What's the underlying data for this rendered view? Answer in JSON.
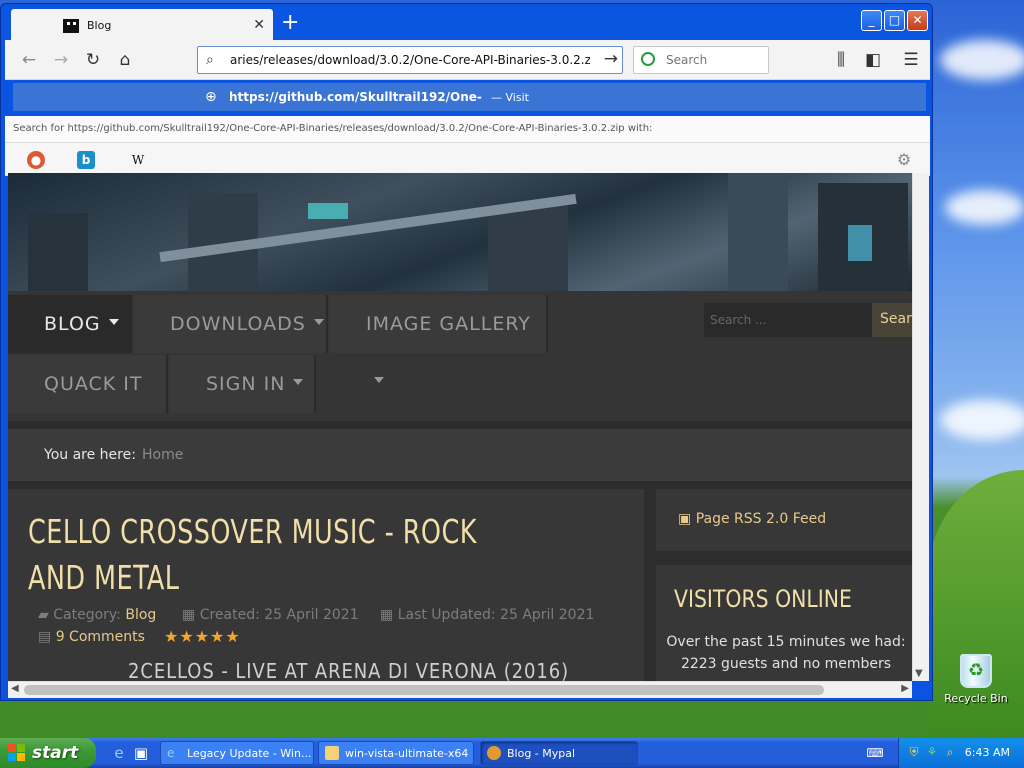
{
  "browser": {
    "tab_title": "Blog",
    "address": "aries/releases/download/3.0.2/One-Core-API-Binaries-3.0.2.zip",
    "search_placeholder": "Search",
    "suggestion_url": "https://github.com/Skulltrail192/One-",
    "suggestion_action": "— Visit",
    "search_for_prefix": "Search for",
    "search_for_url": "https://github.com/Skulltrail192/One-Core-API-Binaries/releases/download/3.0.2/One-Core-API-Binaries-3.0.2.zip",
    "search_for_suffix": "with:",
    "search_engines": [
      "DuckDuckGo",
      "Bing",
      "Wikipedia"
    ]
  },
  "site": {
    "menu": [
      {
        "label": "BLOG",
        "has_dropdown": true
      },
      {
        "label": "DOWNLOADS",
        "has_dropdown": true
      },
      {
        "label": "IMAGE GALLERY",
        "has_dropdown": true
      },
      {
        "label": "QUACK IT",
        "has_dropdown": false
      },
      {
        "label": "SIGN IN",
        "has_dropdown": true
      }
    ],
    "search_placeholder": "Search ...",
    "search_button": "Sear",
    "breadcrumb_label": "You are here:",
    "breadcrumb_home": "Home",
    "article": {
      "title": "CELLO CROSSOVER MUSIC - ROCK AND METAL",
      "category_label": "Category:",
      "category": "Blog",
      "created": "Created: 25 April 2021",
      "updated": "Last Updated: 25 April 2021",
      "comments": "9 Comments",
      "rating_stars": 5,
      "video_title": "2CELLOS - LIVE AT ARENA DI VERONA (2016)"
    },
    "sidebar": {
      "rss": "Page RSS 2.0 Feed",
      "visitors_title": "VISITORS ONLINE",
      "visitors_text": "Over the past 15 minutes we had:",
      "visitors_count": "2223 guests and no members"
    }
  },
  "desktop": {
    "recycle_bin": "Recycle Bin"
  },
  "taskbar": {
    "start": "start",
    "tasks": [
      "Legacy Update - Win...",
      "win-vista-ultimate-x64",
      "Blog - Mypal"
    ],
    "clock": "6:43 AM"
  },
  "colors": {
    "accent_gold": "#e7c98a",
    "xp_blue": "#245edb",
    "star": "#f2a530"
  }
}
